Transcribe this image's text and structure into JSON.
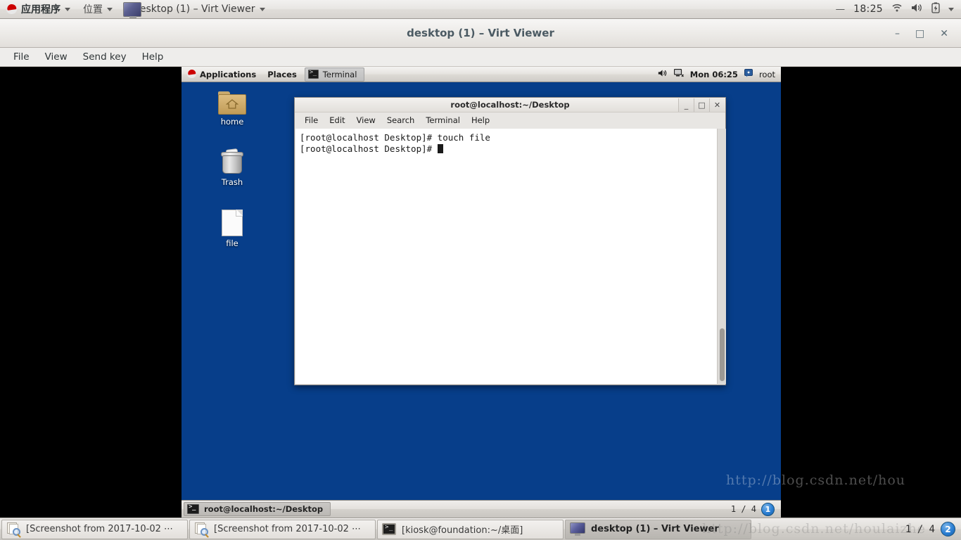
{
  "host_panel": {
    "applications_label": "应用程序",
    "places_label": "位置",
    "active_window_label": "desktop (1) – Virt Viewer",
    "dash": "—",
    "clock": "18:25",
    "icons": {
      "redhat": "redhat-logo-icon",
      "wifi": "wifi-icon",
      "volume": "volume-icon",
      "battery": "battery-charging-icon",
      "menu_caret": "chevron-down-icon"
    }
  },
  "virt_viewer": {
    "title": "desktop (1) – Virt Viewer",
    "window_buttons": {
      "minimize": "–",
      "maximize": "□",
      "close": "✕"
    },
    "menus": [
      "File",
      "View",
      "Send key",
      "Help"
    ]
  },
  "guest_top_panel": {
    "applications_label": "Applications",
    "places_label": "Places",
    "active_task_label": "Terminal",
    "clock": "Mon 06:25",
    "user": "root",
    "icons": {
      "redhat": "redhat-logo-icon",
      "volume": "volume-icon",
      "network": "network-icon",
      "user": "user-icon"
    }
  },
  "desktop_icons": [
    {
      "label": "home",
      "icon": "home-folder-icon"
    },
    {
      "label": "Trash",
      "icon": "trash-icon"
    },
    {
      "label": "file",
      "icon": "document-file-icon"
    }
  ],
  "terminal": {
    "title": "root@localhost:~/Desktop",
    "menus": [
      "File",
      "Edit",
      "View",
      "Search",
      "Terminal",
      "Help"
    ],
    "window_buttons": {
      "minimize": "_",
      "maximize": "□",
      "close": "✕"
    },
    "lines": [
      "[root@localhost Desktop]# touch file",
      "[root@localhost Desktop]# "
    ],
    "prompt": "[root@localhost Desktop]# ",
    "command": "touch file"
  },
  "guest_bottom_panel": {
    "task_label": "root@localhost:~/Desktop",
    "workspace_text": "1 / 4",
    "workspace_badge": "1"
  },
  "host_taskbar": {
    "items": [
      {
        "label": "[Screenshot from 2017-10-02 ⋯",
        "icon": "screenshot-icon",
        "active": false
      },
      {
        "label": "[Screenshot from 2017-10-02 ⋯",
        "icon": "screenshot-icon",
        "active": false
      },
      {
        "label": "[kiosk@foundation:~/桌面]",
        "icon": "terminal-icon",
        "active": false
      },
      {
        "label": "desktop (1) – Virt Viewer",
        "icon": "virt-viewer-icon",
        "active": true
      }
    ],
    "workspace_text": "1 / 4",
    "workspace_badge": "2"
  },
  "watermark": {
    "text": "http://blog.csdn.net/hou",
    "text_bottom": "http://blog.csdn.net/houlaizhe"
  },
  "colors": {
    "desktop_blue": "#073e8a",
    "panel_gray": "#e0ddd9",
    "terminal_bg": "#ffffff",
    "accent_blue": "#2b7fd4",
    "black": "#000000"
  }
}
